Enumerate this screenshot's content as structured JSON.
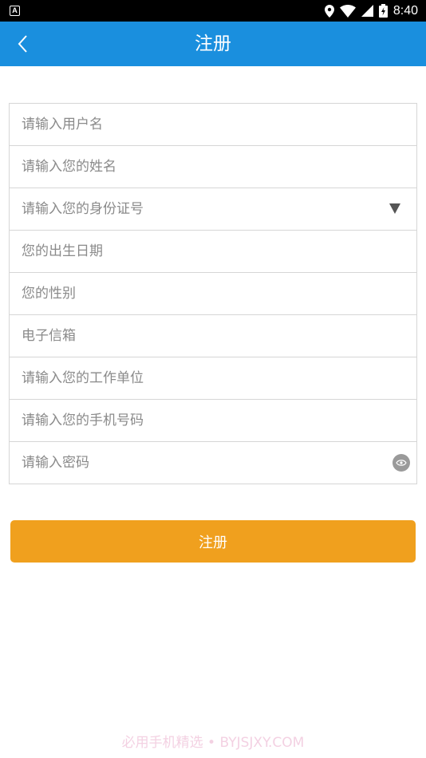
{
  "status_bar": {
    "app_icon_letter": "A",
    "time": "8:40",
    "icons": [
      "location-icon",
      "wifi-icon",
      "signal-icon",
      "battery-icon"
    ]
  },
  "header": {
    "title": "注册",
    "back_icon": "chevron-left-icon",
    "background": "#1a8fde"
  },
  "form": {
    "username_placeholder": "请输入用户名",
    "name_placeholder": "请输入您的姓名",
    "id_card_placeholder": "请输入您的身份证号",
    "birthdate_placeholder": "您的出生日期",
    "gender_placeholder": "您的性别",
    "email_placeholder": "电子信箱",
    "company_placeholder": "请输入您的工作单位",
    "phone_placeholder": "请输入您的手机号码",
    "password_placeholder": "请输入密码"
  },
  "submit": {
    "label": "注册",
    "color": "#f0a01e"
  },
  "watermark": "必用手机精选 • BYJSJXY.COM"
}
